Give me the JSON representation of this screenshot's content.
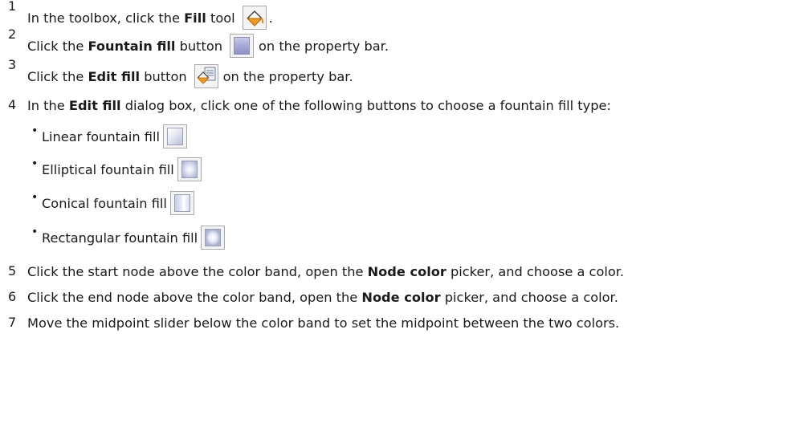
{
  "steps": [
    {
      "num": "1",
      "pre": "In the toolbox, click the ",
      "bold": "Fill",
      "mid": " tool",
      "icon": "fill-tool-icon",
      "post": "."
    },
    {
      "num": "2",
      "pre": "Click the ",
      "bold": "Fountain fill",
      "mid": " button",
      "icon": "fountain-fill-button-icon",
      "post": "on the property bar."
    },
    {
      "num": "3",
      "pre": "Click the ",
      "bold": "Edit fill",
      "mid": " button",
      "icon": "edit-fill-button-icon",
      "post": "on the property bar."
    },
    {
      "num": "4",
      "pre": "In the ",
      "bold": "Edit fill",
      "post": " dialog box, click one of the following buttons to choose a fountain fill type:"
    },
    {
      "num": "5",
      "pre": "Click the start node above the color band, open the ",
      "bold": "Node color",
      "post": " picker, and choose a color."
    },
    {
      "num": "6",
      "pre": "Click the end node above the color band, open the ",
      "bold": "Node color",
      "post": " picker, and choose a color."
    },
    {
      "num": "7",
      "pre": "Move the midpoint slider below the color band to set the midpoint between the two colors."
    }
  ],
  "fill_types": [
    {
      "label": "Linear fountain fill",
      "icon": "linear-fountain-fill-icon"
    },
    {
      "label": "Elliptical fountain fill",
      "icon": "elliptical-fountain-fill-icon"
    },
    {
      "label": "Conical fountain fill",
      "icon": "conical-fountain-fill-icon"
    },
    {
      "label": "Rectangular fountain fill",
      "icon": "rectangular-fountain-fill-icon"
    }
  ],
  "bullet_glyph": "•"
}
